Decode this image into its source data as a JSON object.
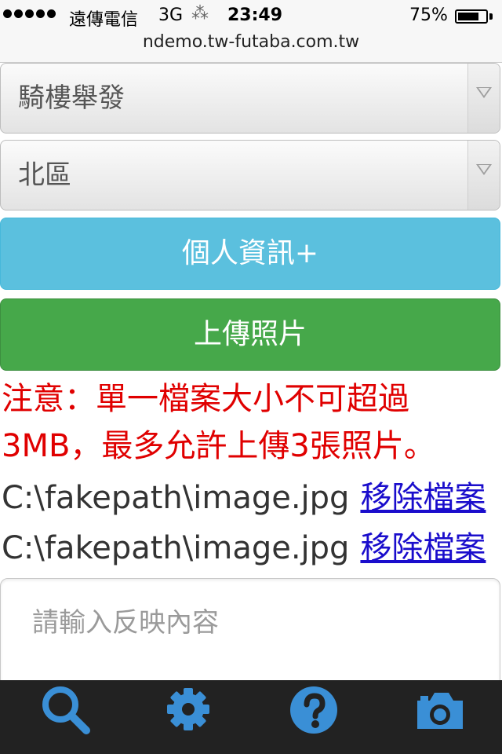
{
  "status_bar": {
    "carrier": "遠傳電信",
    "network": "3G",
    "activity": "⁂",
    "time": "23:49",
    "battery": "75%",
    "battery_level": 0.75
  },
  "browser": {
    "url": "ndemo.tw-futaba.com.tw"
  },
  "form": {
    "category_select": "騎樓舉發",
    "district_select": "北區",
    "personal_info_button": "個人資訊+",
    "upload_photo_button": "上傳照片",
    "notice": "注意：單一檔案大小不可超過3MB，最多允許上傳3張照片。",
    "files": [
      {
        "path": "C:\\fakepath\\image.jpg",
        "remove_label": "移除檔案"
      },
      {
        "path": "C:\\fakepath\\image.jpg",
        "remove_label": "移除檔案"
      }
    ],
    "content_placeholder": "請輸入反映內容"
  },
  "tab_bar": {
    "accent_color": "#3a8fd6",
    "background_color": "#222222",
    "items": [
      {
        "icon": "search-icon"
      },
      {
        "icon": "gear-icon"
      },
      {
        "icon": "help-icon"
      },
      {
        "icon": "camera-icon"
      }
    ]
  }
}
